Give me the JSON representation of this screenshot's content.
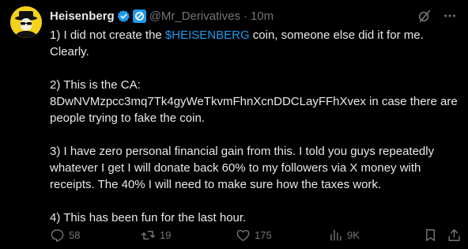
{
  "author": {
    "display_name": "Heisenberg",
    "handle": "@Mr_Derivatives",
    "separator": "·",
    "time": "10m"
  },
  "post": {
    "p1_before": "1) I did not create the ",
    "p1_cashtag": "$HEISENBERG",
    "p1_after": " coin, someone else did it for me. Clearly.",
    "p2_line1": "2) This is the CA:",
    "p2_line2": "8DwNVMzpcc3mq7Tk4gyWeTkvmFhnXcnDDCLayFFhXvex in case there are people trying to fake the coin.",
    "p3": "3) I have zero personal financial gain from this. I told you guys repeatedly whatever I get I will donate back 60% to my followers via X money with receipts. The 40% I will need to make sure how the taxes work.",
    "p4": "4) This has been fun for the last hour."
  },
  "actions": {
    "replies": "58",
    "reposts": "19",
    "likes": "175",
    "views": "9K"
  },
  "colors": {
    "background": "#000000",
    "text": "#e7e9ea",
    "muted": "#71767b",
    "accent": "#1d9bf0",
    "avatar_bg": "#f2d21b"
  },
  "icons": [
    "avatar",
    "verified-badge-icon",
    "affiliate-badge-icon",
    "grok-icon",
    "more-icon",
    "reply-icon",
    "repost-icon",
    "like-icon",
    "views-icon",
    "bookmark-icon",
    "share-icon"
  ]
}
